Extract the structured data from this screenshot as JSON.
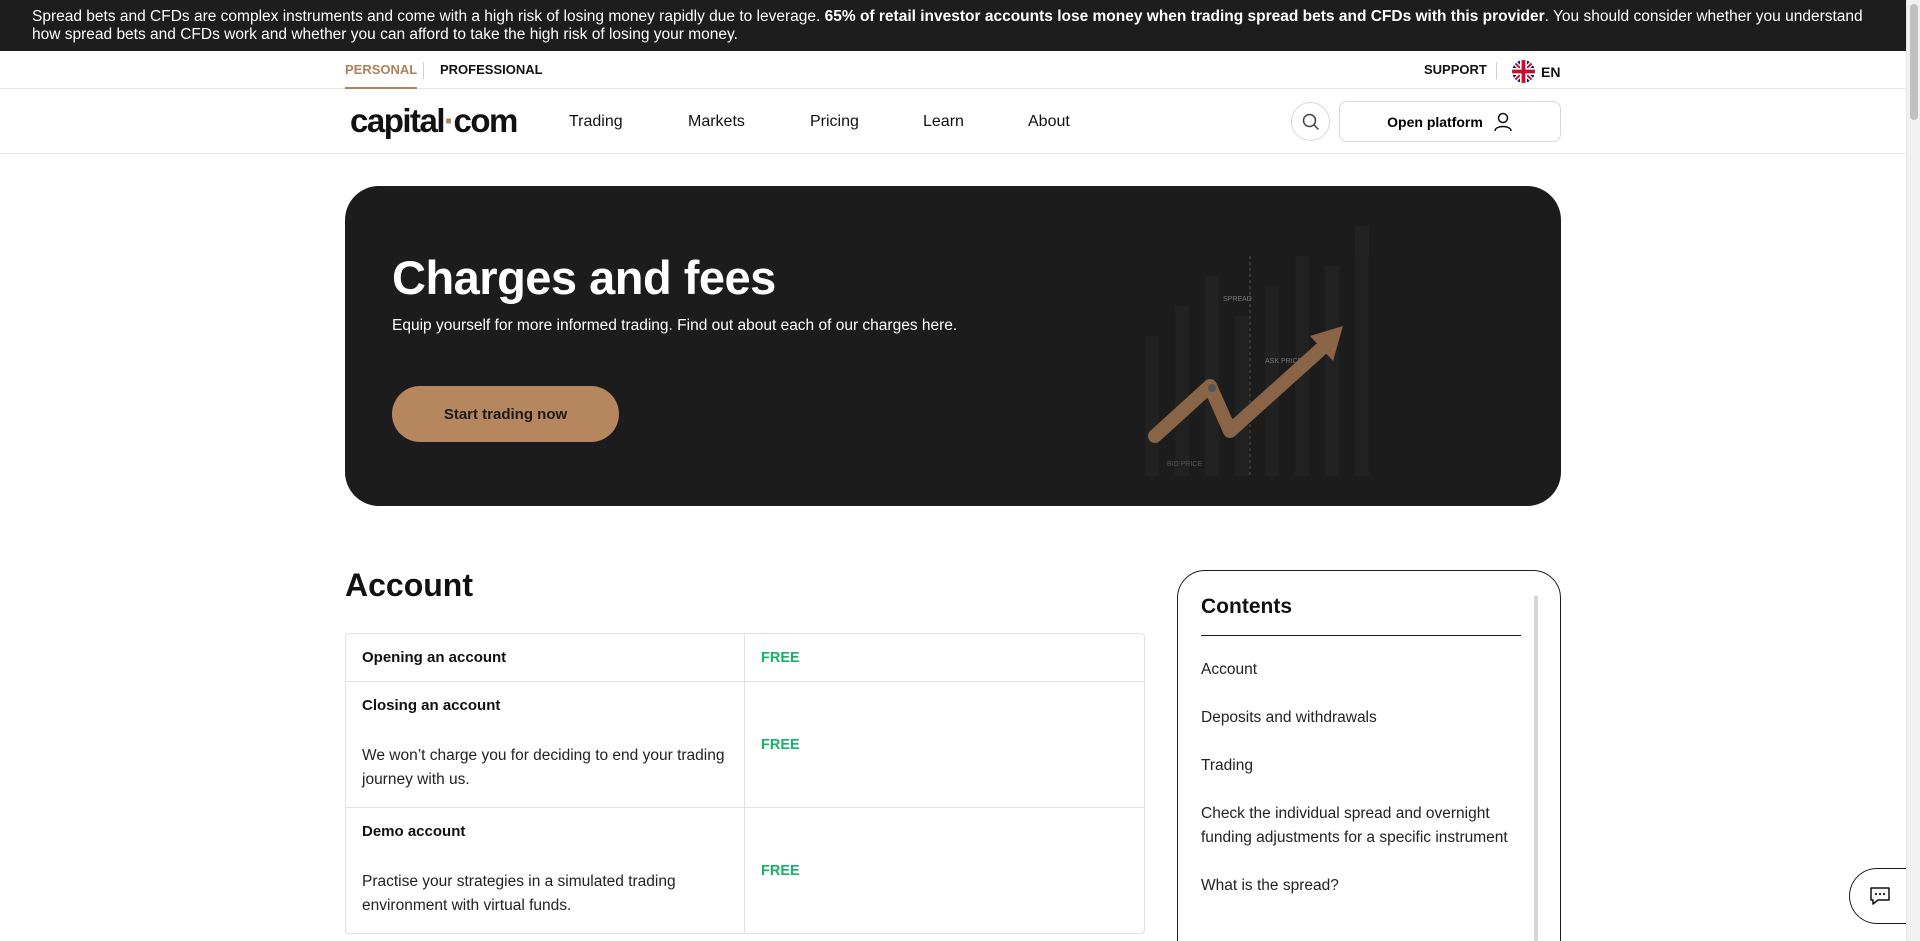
{
  "risk_banner": {
    "text_start": "Spread bets and CFDs are complex instruments and come with a high risk of losing money rapidly due to leverage. ",
    "text_bold": "65% of retail investor accounts lose money when trading spread bets and CFDs with this provider",
    "text_end": ". You should consider whether you understand how spread bets and CFDs work and whether you can afford to take the high risk of losing your money."
  },
  "topbar": {
    "personal_label": "PERSONAL",
    "professional_label": "PROFESSIONAL",
    "support_label": "SUPPORT",
    "language_label": "EN",
    "language_icon": "uk-flag-icon"
  },
  "nav": {
    "logo_left": "capital",
    "logo_dot": "·",
    "logo_right": "com",
    "items": [
      {
        "label": "Trading"
      },
      {
        "label": "Markets"
      },
      {
        "label": "Pricing"
      },
      {
        "label": "Learn"
      },
      {
        "label": "About"
      }
    ],
    "search_icon": "search-icon",
    "open_platform_label": "Open platform",
    "user_icon": "user-icon"
  },
  "hero": {
    "title": "Charges and fees",
    "subtitle": "Equip yourself for more informed trading. Find out about each of our charges here.",
    "cta_label": "Start trading now",
    "chart_labels": {
      "spread": "SPREAD",
      "ask": "ASK PRICE",
      "bid": "BID PRICE"
    }
  },
  "account": {
    "title": "Account",
    "rows": [
      {
        "title": "Opening an account",
        "description": "",
        "value": "FREE"
      },
      {
        "title": "Closing an account",
        "description": "We won’t charge you for deciding to end your trading journey with us.",
        "value": "FREE"
      },
      {
        "title": "Demo account",
        "description": "Practise your strategies in a simulated trading environment with virtual funds.",
        "value": "FREE"
      }
    ]
  },
  "contents": {
    "title": "Contents",
    "links": [
      {
        "label": "Account"
      },
      {
        "label": "Deposits and withdrawals"
      },
      {
        "label": "Trading"
      },
      {
        "label": "Check the individual spread and overnight funding adjustments for a specific instrument"
      },
      {
        "label": "What is the spread?"
      }
    ]
  },
  "colors": {
    "accent": "#b6865e",
    "free_green": "#17b26a",
    "dark": "#1c1c1c"
  },
  "chat": {
    "icon": "chat-icon"
  }
}
